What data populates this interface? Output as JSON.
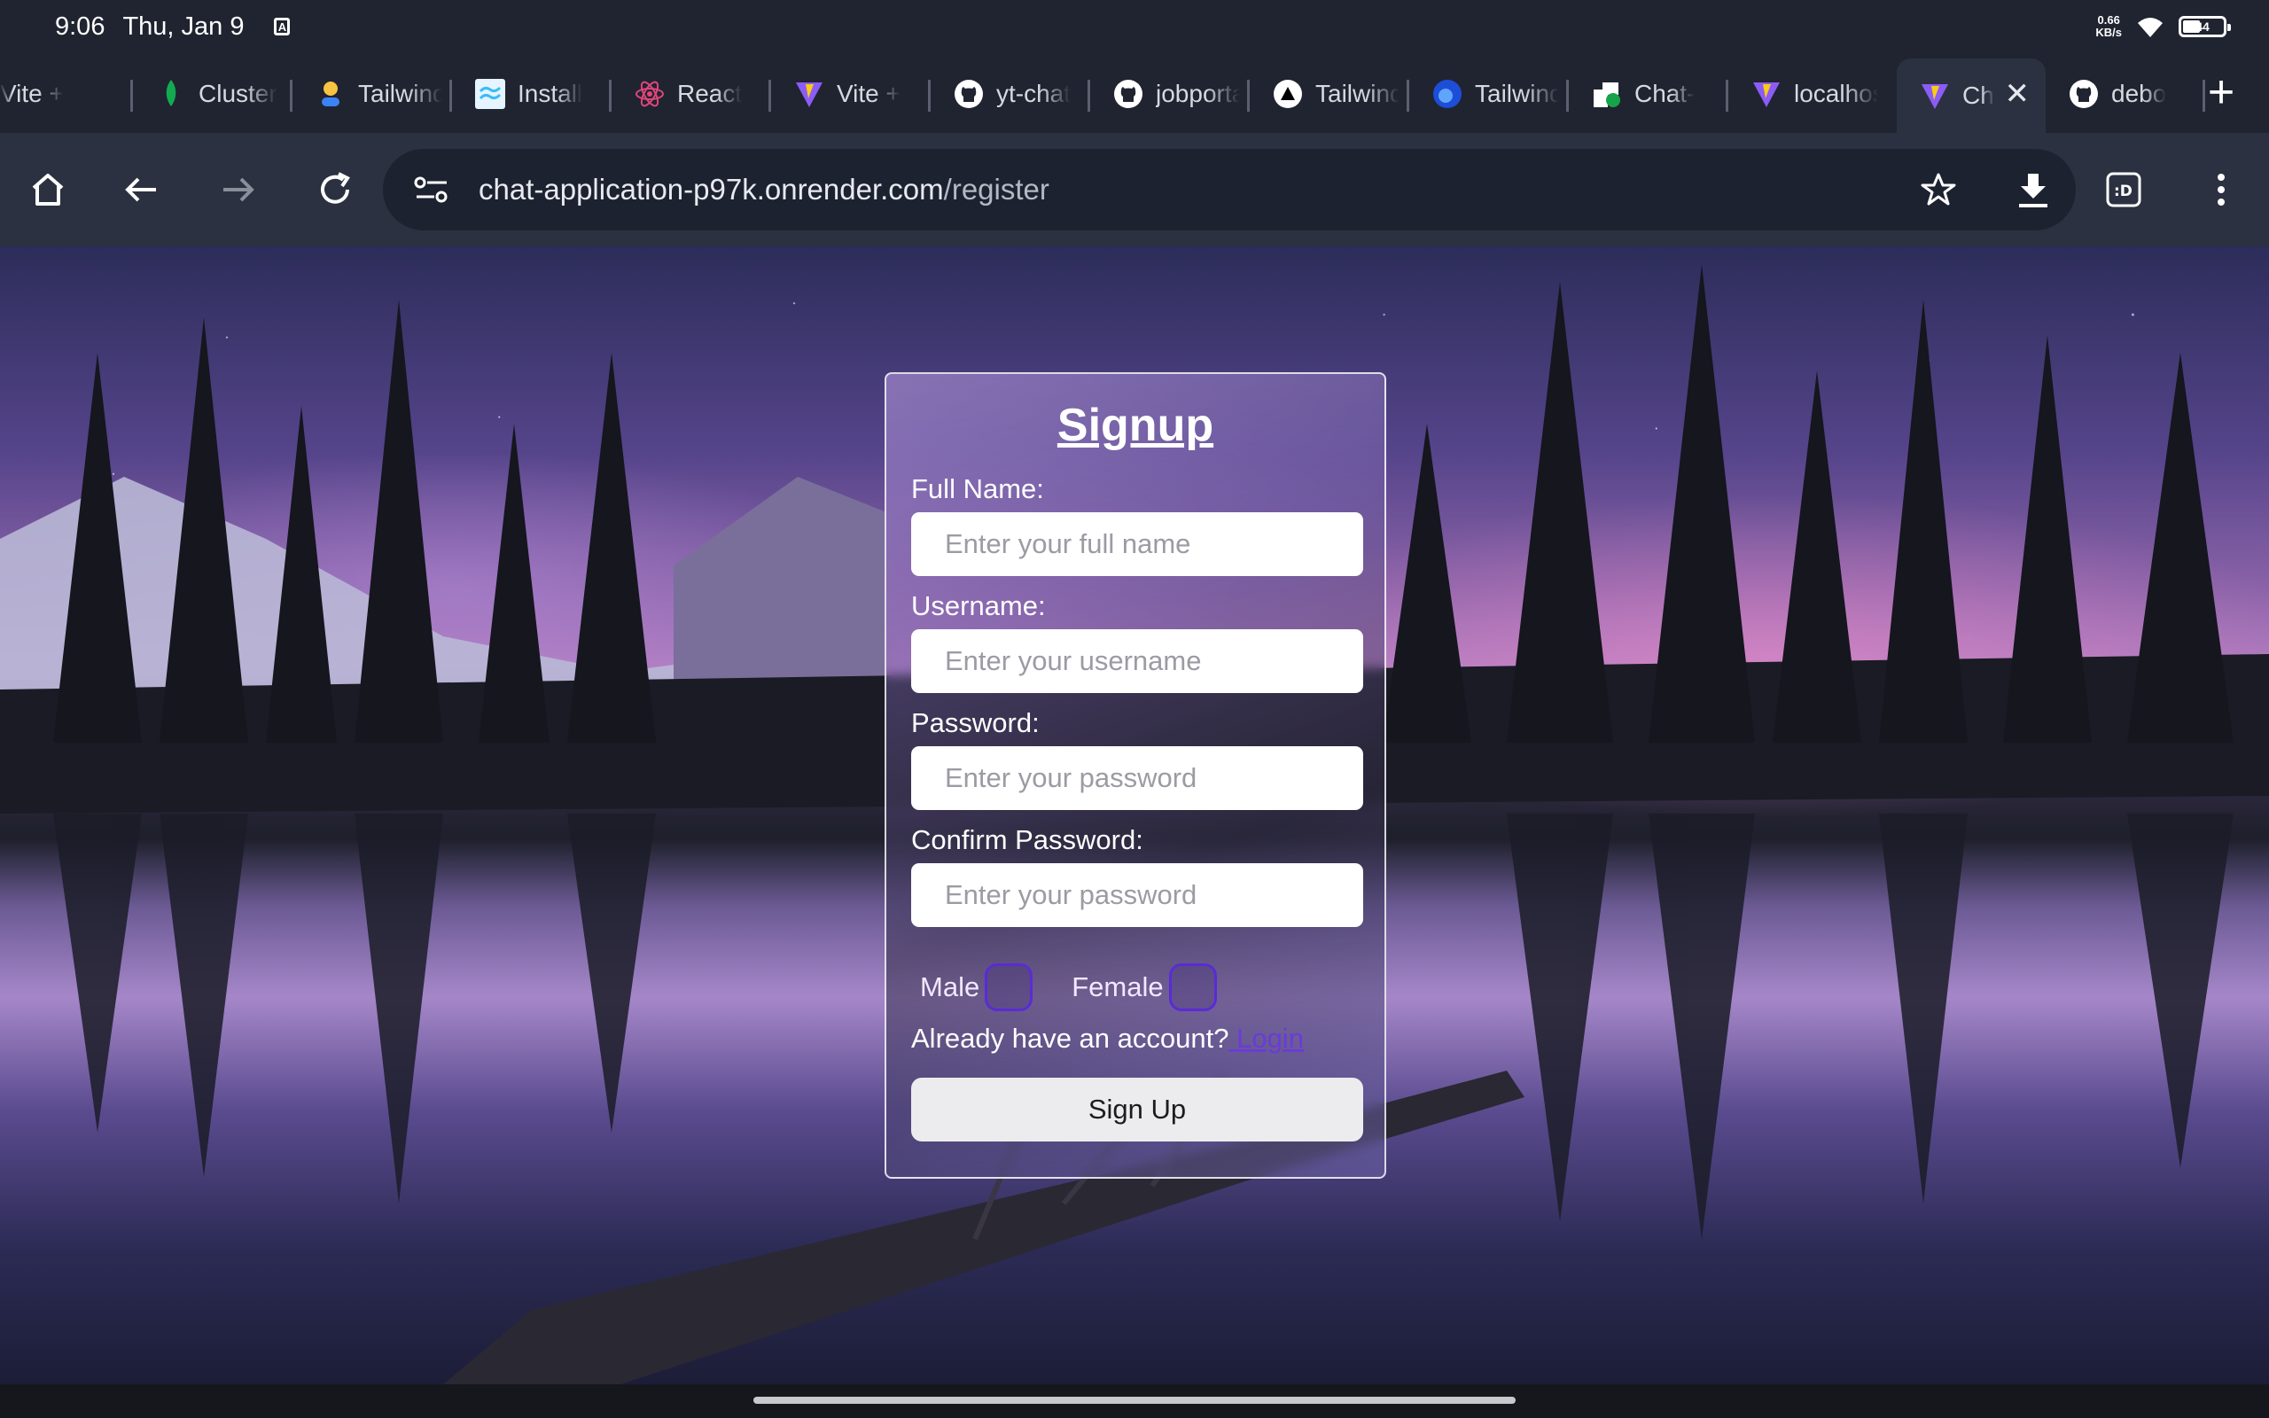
{
  "status_bar": {
    "time": "9:06",
    "date": "Thu, Jan 9",
    "net_speed_value": "0.66",
    "net_speed_unit": "KB/s",
    "battery": "44"
  },
  "tabs": [
    {
      "label": "Vite +",
      "icon": "vite-icon"
    },
    {
      "label": "Cluster",
      "icon": "mongodb-leaf-icon"
    },
    {
      "label": "Tailwind",
      "icon": "tailwind-avatar-icon"
    },
    {
      "label": "Install",
      "icon": "tailwind-icon"
    },
    {
      "label": "React",
      "icon": "react-icon"
    },
    {
      "label": "Vite +",
      "icon": "vite-icon"
    },
    {
      "label": "yt-chat",
      "icon": "github-icon"
    },
    {
      "label": "jobportal",
      "icon": "github-icon"
    },
    {
      "label": "Tailwind",
      "icon": "vercel-icon"
    },
    {
      "label": "Tailwind",
      "icon": "flowbite-icon"
    },
    {
      "label": "Chat-",
      "icon": "render-icon"
    },
    {
      "label": "localhost",
      "icon": "vite-icon"
    },
    {
      "label": "Ch",
      "icon": "vite-icon",
      "active": true
    },
    {
      "label": "debo",
      "icon": "github-icon"
    }
  ],
  "toolbar": {
    "url_host": "chat-application-p97k.onrender.com",
    "url_path": "/register"
  },
  "signup": {
    "title": "Signup",
    "fullname_label": "Full Name:",
    "fullname_placeholder": "Enter your full name",
    "username_label": "Username:",
    "username_placeholder": "Enter your username",
    "password_label": "Password:",
    "password_placeholder": "Enter your password",
    "confirm_label": "Confirm Password:",
    "confirm_placeholder": "Enter your password",
    "male_label": "Male",
    "female_label": "Female",
    "account_text": "Already have an account?",
    "login_link": " Login",
    "submit_label": "Sign Up"
  }
}
